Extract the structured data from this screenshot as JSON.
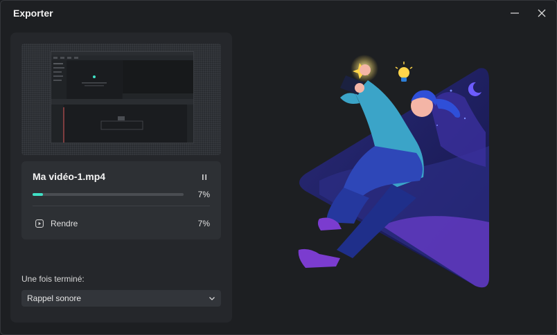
{
  "window": {
    "title": "Exporter",
    "minimize_icon": "minimize-icon",
    "close_icon": "close-icon"
  },
  "export": {
    "filename": "Ma vidéo-1.mp4",
    "progress": 0.07,
    "progress_label": "7%",
    "pause_icon": "pause-icon",
    "step": {
      "icon": "play-square-icon",
      "label": "Rendre",
      "progress_label": "7%"
    }
  },
  "after": {
    "label": "Une fois terminé:",
    "selected": "Rappel sonore",
    "chevron_icon": "chevron-down-icon"
  },
  "colors": {
    "accent": "#3fe0c5",
    "background": "#1d1f22",
    "panel": "#25272b",
    "card": "#2d3034"
  }
}
